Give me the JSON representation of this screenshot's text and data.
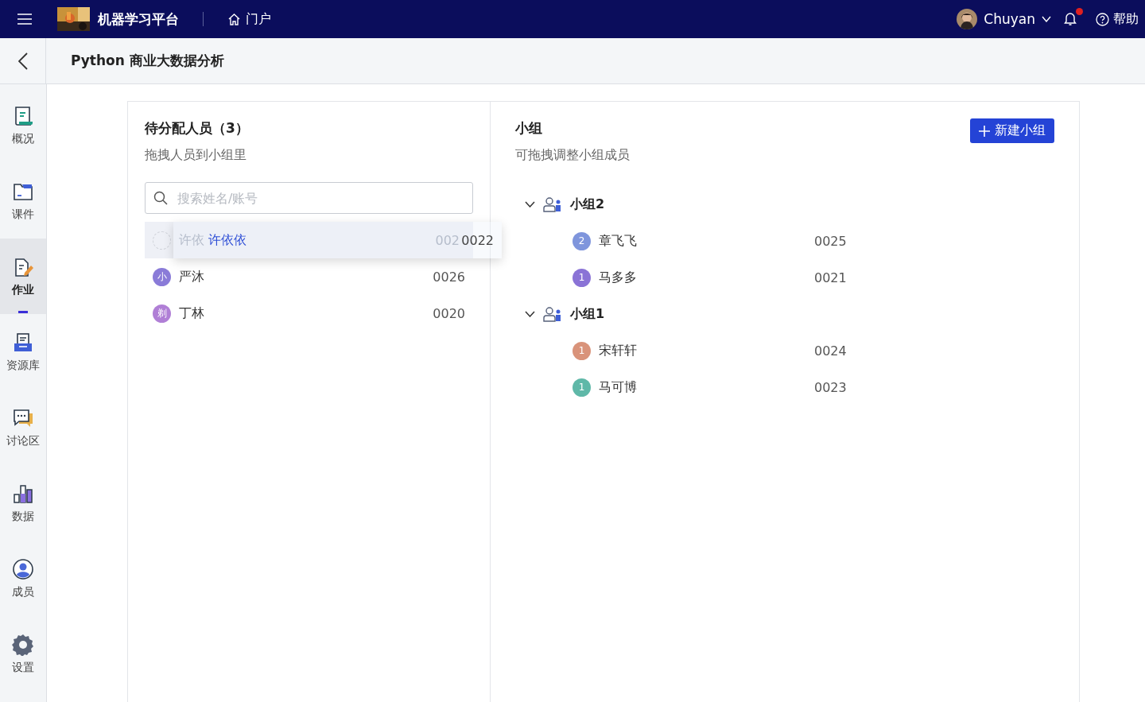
{
  "topbar": {
    "platform_name": "机器学习平台",
    "portal_link": "门户",
    "user_name": "Chuyan",
    "has_notification": true,
    "help_link": "帮助"
  },
  "course_title": "Python 商业大数据分析",
  "sidebar": {
    "items": [
      {
        "label": "概况",
        "selected": false
      },
      {
        "label": "课件",
        "selected": false
      },
      {
        "label": "作业",
        "selected": true
      },
      {
        "label": "资源库",
        "selected": false
      },
      {
        "label": "讨论区",
        "selected": false
      },
      {
        "label": "数据",
        "selected": false
      },
      {
        "label": "成员",
        "selected": false
      },
      {
        "label": "设置",
        "selected": false
      }
    ]
  },
  "unassigned": {
    "title": "待分配人员（3）",
    "subtitle": "拖拽人员到小组里",
    "search": {
      "placeholder": "搜索姓名/账号"
    },
    "members": [
      {
        "kind": "dragging",
        "name": "许依",
        "account": "002",
        "drag_name": "许依依",
        "drag_account": "0022"
      },
      {
        "kind": "normal",
        "avatar": "小",
        "color": "#8a7bd8",
        "name": "严沐",
        "account": "0026"
      },
      {
        "kind": "normal",
        "avatar": "剃",
        "color": "#b07fd6",
        "name": "丁林",
        "account": "0020"
      }
    ]
  },
  "groups_panel": {
    "title": "小组",
    "subtitle": "可拖拽调整小组成员",
    "new_button": "新建小组",
    "groups": [
      {
        "name": "小组2",
        "expanded": true,
        "children": [
          {
            "avatar": "2",
            "color": "#7f95dc",
            "name": "章飞飞",
            "account": "0025"
          },
          {
            "avatar": "1",
            "color": "#8a73d6",
            "name": "马多多",
            "account": "0021"
          }
        ]
      },
      {
        "name": "小组1",
        "expanded": true,
        "children": [
          {
            "avatar": "1",
            "color": "#d9937a",
            "name": "宋轩轩",
            "account": "0024"
          },
          {
            "avatar": "1",
            "color": "#5fb8a8",
            "name": "马可博",
            "account": "0023"
          }
        ]
      }
    ]
  }
}
